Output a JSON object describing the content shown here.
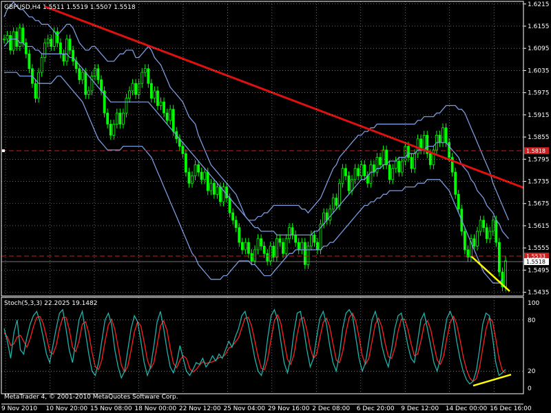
{
  "window": {
    "title": "GBPUSD,H4  1.5511 1.5519 1.5507 1.5518",
    "symbol": "GBPUSD,H4",
    "ohlc": "1.5511 1.5519 1.5507 1.5518",
    "footer": "MetaTrader 4, © 2001-2010 MetaQuotes Software Corp."
  },
  "colors": {
    "background": "#000000",
    "bull_candle": "#00ff00",
    "bear_candle": "#00ff00",
    "bollinger": "#7b9bdf",
    "trendline": "#e01010",
    "price_line": "#c82020",
    "yellow": "#ffff00",
    "stoch_main": "#20b2aa",
    "stoch_signal": "#ff2020",
    "grid": "#ffffff",
    "axis_text": "#ffffff"
  },
  "chart_data": [
    {
      "type": "line",
      "title": "GBPUSD,H4",
      "subtitle": "1.5511 1.5519 1.5507 1.5518",
      "price_ticks": [
        "1.6215",
        "1.6155",
        "1.6095",
        "1.6035",
        "1.5975",
        "1.5915",
        "1.5855",
        "1.5795",
        "1.5735",
        "1.5675",
        "1.5615",
        "1.5555",
        "1.5495",
        "1.5435"
      ],
      "y_range": [
        1.5425,
        1.6222
      ],
      "x_ticks": [
        "9 Nov 2010",
        "10 Nov 20:00",
        "15 Nov 08:00",
        "18 Nov 00:00",
        "22 Nov 12:00",
        "25 Nov 04:00",
        "29 Nov 16:00",
        "2 Dec 08:00",
        "6 Dec 20:00",
        "9 Dec 12:00",
        "14 Dec 00:00",
        "16 Dec 16:00"
      ],
      "horizontal_lines": [
        {
          "label": "1.5818",
          "value": 1.5818
        },
        {
          "label": "1.5533",
          "value": 1.5533
        },
        {
          "label": "1.5518",
          "value": 1.5518
        }
      ],
      "close_series": [
        1.612,
        1.613,
        1.609,
        1.614,
        1.61,
        1.615,
        1.611,
        1.608,
        1.604,
        1.6,
        1.596,
        1.603,
        1.607,
        1.611,
        1.612,
        1.61,
        1.614,
        1.611,
        1.608,
        1.606,
        1.612,
        1.609,
        1.606,
        1.604,
        1.601,
        1.603,
        1.597,
        1.598,
        1.602,
        1.604,
        1.601,
        1.598,
        1.592,
        1.589,
        1.586,
        1.589,
        1.592,
        1.589,
        1.592,
        1.596,
        1.598,
        1.6,
        1.597,
        1.6,
        1.603,
        1.604,
        1.6,
        1.596,
        1.598,
        1.594,
        1.595,
        1.592,
        1.59,
        1.593,
        1.587,
        1.585,
        1.583,
        1.581,
        1.576,
        1.573,
        1.575,
        1.578,
        1.576,
        1.574,
        1.576,
        1.571,
        1.573,
        1.57,
        1.572,
        1.568,
        1.572,
        1.569,
        1.565,
        1.563,
        1.561,
        1.557,
        1.555,
        1.557,
        1.554,
        1.552,
        1.555,
        1.558,
        1.556,
        1.554,
        1.552,
        1.556,
        1.553,
        1.558,
        1.557,
        1.554,
        1.558,
        1.561,
        1.559,
        1.557,
        1.555,
        1.557,
        1.551,
        1.556,
        1.559,
        1.557,
        1.555,
        1.562,
        1.565,
        1.563,
        1.566,
        1.569,
        1.567,
        1.573,
        1.577,
        1.575,
        1.571,
        1.574,
        1.577,
        1.575,
        1.578,
        1.575,
        1.573,
        1.578,
        1.576,
        1.58,
        1.578,
        1.582,
        1.578,
        1.574,
        1.577,
        1.579,
        1.576,
        1.579,
        1.583,
        1.58,
        1.577,
        1.581,
        1.585,
        1.582,
        1.586,
        1.581,
        1.578,
        1.582,
        1.586,
        1.584,
        1.588,
        1.584,
        1.58,
        1.576,
        1.57,
        1.566,
        1.56,
        1.555,
        1.553,
        1.558,
        1.556,
        1.56,
        1.563,
        1.561,
        1.558,
        1.56,
        1.563,
        1.557,
        1.549,
        1.545,
        1.552
      ],
      "bollinger_upper": [
        1.618,
        1.62,
        1.621,
        1.622,
        1.621,
        1.62,
        1.62,
        1.619,
        1.618,
        1.618,
        1.617,
        1.617,
        1.616,
        1.616,
        1.616,
        1.615,
        1.614,
        1.613,
        1.614,
        1.615,
        1.616,
        1.616,
        1.615,
        1.613,
        1.611,
        1.61,
        1.609,
        1.609,
        1.61,
        1.61,
        1.609,
        1.608,
        1.607,
        1.606,
        1.606,
        1.606,
        1.607,
        1.608,
        1.608,
        1.609,
        1.609,
        1.609,
        1.607,
        1.607,
        1.608,
        1.609,
        1.61,
        1.609,
        1.607,
        1.606,
        1.605,
        1.603,
        1.601,
        1.599,
        1.598,
        1.597,
        1.596,
        1.595,
        1.593,
        1.591,
        1.59,
        1.589,
        1.586,
        1.584,
        1.582,
        1.58,
        1.578,
        1.577,
        1.576,
        1.575,
        1.574,
        1.573,
        1.572,
        1.571,
        1.57,
        1.568,
        1.566,
        1.564,
        1.563,
        1.563,
        1.563,
        1.564,
        1.564,
        1.565,
        1.565,
        1.566,
        1.567,
        1.567,
        1.567,
        1.567,
        1.567,
        1.567,
        1.567,
        1.567,
        1.567,
        1.566,
        1.566,
        1.565,
        1.566,
        1.567,
        1.568,
        1.569,
        1.571,
        1.573,
        1.575,
        1.577,
        1.578,
        1.58,
        1.581,
        1.582,
        1.583,
        1.584,
        1.585,
        1.586,
        1.586,
        1.587,
        1.587,
        1.588,
        1.588,
        1.589,
        1.589,
        1.589,
        1.589,
        1.589,
        1.589,
        1.589,
        1.589,
        1.589,
        1.589,
        1.589,
        1.589,
        1.589,
        1.59,
        1.59,
        1.591,
        1.591,
        1.591,
        1.591,
        1.592,
        1.592,
        1.593,
        1.594,
        1.594,
        1.594,
        1.594,
        1.593,
        1.593,
        1.592,
        1.59,
        1.588,
        1.586,
        1.584,
        1.582,
        1.58,
        1.578,
        1.576,
        1.573,
        1.571,
        1.569,
        1.567,
        1.565,
        1.563
      ],
      "bollinger_middle": [
        1.61,
        1.611,
        1.612,
        1.612,
        1.612,
        1.611,
        1.611,
        1.61,
        1.61,
        1.61,
        1.609,
        1.609,
        1.608,
        1.608,
        1.608,
        1.608,
        1.608,
        1.608,
        1.608,
        1.608,
        1.608,
        1.607,
        1.607,
        1.606,
        1.605,
        1.604,
        1.603,
        1.602,
        1.601,
        1.6,
        1.599,
        1.598,
        1.597,
        1.596,
        1.595,
        1.595,
        1.595,
        1.595,
        1.595,
        1.595,
        1.595,
        1.595,
        1.595,
        1.595,
        1.595,
        1.595,
        1.595,
        1.594,
        1.593,
        1.592,
        1.591,
        1.59,
        1.589,
        1.588,
        1.587,
        1.586,
        1.585,
        1.584,
        1.583,
        1.582,
        1.581,
        1.58,
        1.579,
        1.578,
        1.577,
        1.576,
        1.575,
        1.574,
        1.573,
        1.572,
        1.571,
        1.57,
        1.569,
        1.568,
        1.567,
        1.566,
        1.565,
        1.564,
        1.563,
        1.562,
        1.561,
        1.561,
        1.56,
        1.56,
        1.56,
        1.56,
        1.56,
        1.559,
        1.559,
        1.559,
        1.559,
        1.559,
        1.559,
        1.559,
        1.559,
        1.559,
        1.559,
        1.559,
        1.559,
        1.56,
        1.56,
        1.561,
        1.562,
        1.563,
        1.564,
        1.565,
        1.566,
        1.567,
        1.568,
        1.569,
        1.57,
        1.571,
        1.572,
        1.573,
        1.574,
        1.574,
        1.575,
        1.576,
        1.576,
        1.577,
        1.577,
        1.578,
        1.578,
        1.579,
        1.579,
        1.579,
        1.58,
        1.58,
        1.58,
        1.581,
        1.581,
        1.581,
        1.582,
        1.582,
        1.582,
        1.583,
        1.583,
        1.583,
        1.584,
        1.584,
        1.584,
        1.584,
        1.583,
        1.582,
        1.581,
        1.58,
        1.578,
        1.577,
        1.576,
        1.574,
        1.573,
        1.571,
        1.57,
        1.569,
        1.567,
        1.566,
        1.565,
        1.563,
        1.562,
        1.56,
        1.559,
        1.558
      ],
      "bollinger_lower": [
        1.603,
        1.603,
        1.603,
        1.603,
        1.603,
        1.602,
        1.602,
        1.602,
        1.602,
        1.602,
        1.601,
        1.6,
        1.6,
        1.6,
        1.6,
        1.6,
        1.601,
        1.602,
        1.602,
        1.601,
        1.6,
        1.599,
        1.598,
        1.597,
        1.596,
        1.595,
        1.593,
        1.591,
        1.589,
        1.587,
        1.585,
        1.584,
        1.583,
        1.582,
        1.582,
        1.582,
        1.582,
        1.582,
        1.583,
        1.583,
        1.583,
        1.583,
        1.583,
        1.583,
        1.583,
        1.582,
        1.581,
        1.58,
        1.578,
        1.576,
        1.574,
        1.572,
        1.57,
        1.568,
        1.566,
        1.564,
        1.562,
        1.56,
        1.558,
        1.556,
        1.554,
        1.553,
        1.551,
        1.55,
        1.549,
        1.548,
        1.547,
        1.547,
        1.547,
        1.547,
        1.548,
        1.548,
        1.549,
        1.55,
        1.551,
        1.552,
        1.552,
        1.552,
        1.552,
        1.551,
        1.551,
        1.55,
        1.549,
        1.548,
        1.548,
        1.548,
        1.549,
        1.55,
        1.551,
        1.552,
        1.553,
        1.554,
        1.554,
        1.555,
        1.555,
        1.555,
        1.555,
        1.555,
        1.555,
        1.555,
        1.555,
        1.555,
        1.556,
        1.556,
        1.557,
        1.557,
        1.558,
        1.559,
        1.56,
        1.561,
        1.562,
        1.563,
        1.564,
        1.565,
        1.566,
        1.567,
        1.567,
        1.568,
        1.568,
        1.569,
        1.569,
        1.57,
        1.57,
        1.571,
        1.571,
        1.571,
        1.571,
        1.571,
        1.572,
        1.572,
        1.572,
        1.572,
        1.573,
        1.573,
        1.573,
        1.574,
        1.574,
        1.574,
        1.574,
        1.574,
        1.573,
        1.572,
        1.571,
        1.569,
        1.567,
        1.565,
        1.563,
        1.561,
        1.559,
        1.557,
        1.555,
        1.553,
        1.551,
        1.549,
        1.548,
        1.547,
        1.546,
        1.546,
        1.546,
        1.547
      ]
    },
    {
      "type": "line",
      "title": "Stoch(5,3,3) 22.2025 19.1482",
      "indicator": "Stoch(5,3,3)",
      "main_value": "22.2025",
      "signal_value": "19.1482",
      "y_range": [
        0,
        100
      ],
      "levels": [
        {
          "label": "80",
          "value": 80
        },
        {
          "label": "20",
          "value": 20
        }
      ],
      "y_ticks": [
        "100",
        "80",
        "20",
        "0"
      ],
      "series": [
        {
          "name": "main",
          "values": [
            70,
            55,
            35,
            65,
            80,
            45,
            40,
            60,
            75,
            85,
            90,
            78,
            60,
            40,
            30,
            50,
            70,
            88,
            92,
            70,
            45,
            30,
            55,
            80,
            90,
            65,
            40,
            20,
            15,
            30,
            55,
            80,
            88,
            75,
            45,
            25,
            12,
            20,
            45,
            70,
            85,
            78,
            55,
            30,
            15,
            25,
            50,
            78,
            90,
            70,
            45,
            25,
            18,
            30,
            50,
            35,
            20,
            15,
            22,
            30,
            28,
            35,
            25,
            30,
            38,
            32,
            40,
            35,
            45,
            55,
            48,
            60,
            70,
            85,
            90,
            75,
            55,
            35,
            20,
            15,
            30,
            60,
            85,
            92,
            80,
            55,
            30,
            18,
            35,
            65,
            88,
            90,
            70,
            45,
            25,
            35,
            60,
            82,
            90,
            75,
            50,
            30,
            20,
            40,
            70,
            88,
            92,
            85,
            60,
            35,
            20,
            30,
            55,
            80,
            90,
            75,
            50,
            35,
            25,
            45,
            70,
            85,
            88,
            70,
            50,
            35,
            30,
            55,
            80,
            88,
            70,
            50,
            30,
            20,
            35,
            60,
            82,
            90,
            80,
            55,
            35,
            20,
            10,
            5,
            8,
            20,
            45,
            75,
            88,
            85,
            60,
            30,
            15,
            18,
            22
          ]
        },
        {
          "name": "signal",
          "values": [
            65,
            60,
            50,
            52,
            60,
            62,
            55,
            48,
            58,
            72,
            83,
            84,
            76,
            60,
            43,
            40,
            50,
            70,
            83,
            83,
            69,
            48,
            43,
            55,
            75,
            78,
            65,
            42,
            25,
            22,
            33,
            55,
            74,
            81,
            69,
            48,
            27,
            19,
            26,
            45,
            66,
            78,
            73,
            54,
            33,
            23,
            30,
            51,
            73,
            79,
            68,
            47,
            29,
            24,
            33,
            38,
            35,
            23,
            19,
            22,
            27,
            31,
            29,
            30,
            31,
            33,
            36,
            36,
            40,
            47,
            49,
            54,
            59,
            71,
            82,
            83,
            73,
            55,
            37,
            23,
            22,
            35,
            58,
            79,
            86,
            76,
            55,
            34,
            28,
            39,
            63,
            81,
            83,
            68,
            47,
            35,
            40,
            59,
            77,
            82,
            72,
            52,
            33,
            30,
            43,
            66,
            83,
            88,
            79,
            60,
            38,
            28,
            35,
            55,
            75,
            82,
            72,
            53,
            37,
            35,
            47,
            67,
            81,
            81,
            69,
            52,
            38,
            40,
            55,
            74,
            79,
            69,
            50,
            33,
            28,
            38,
            59,
            77,
            84,
            75,
            57,
            37,
            22,
            12,
            8,
            11,
            24,
            47,
            69,
            83,
            78,
            58,
            35,
            21,
            18
          ]
        }
      ]
    }
  ]
}
